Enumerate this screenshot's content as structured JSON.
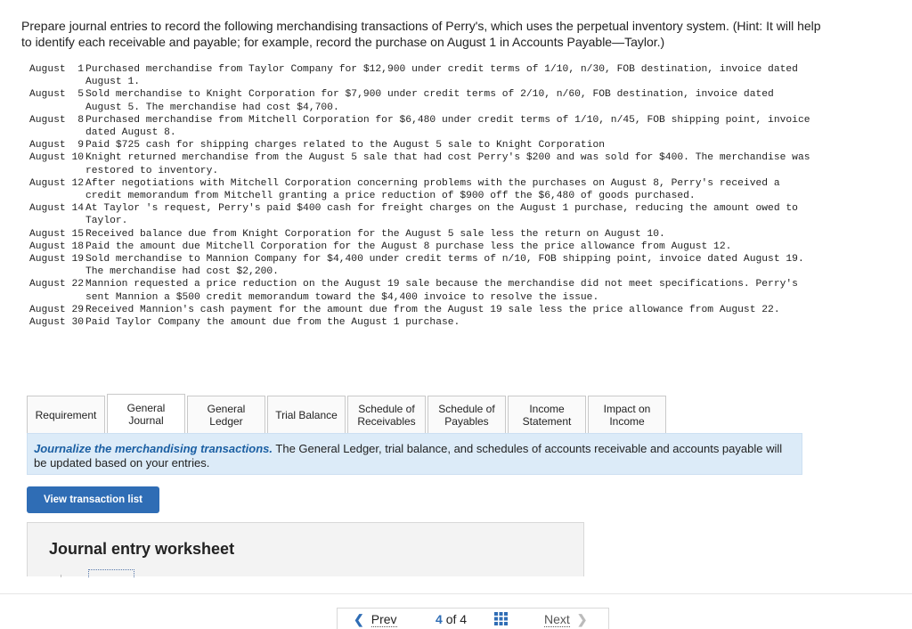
{
  "prompt": {
    "text": "Prepare journal entries to record the following merchandising transactions of Perry's, which uses the perpetual inventory system. (Hint: It will help to identify each receivable and payable; for example, record the purchase on August 1 in Accounts Payable—Taylor.)"
  },
  "transactions": [
    {
      "date": "August  1",
      "text": "Purchased merchandise from Taylor Company for $12,900 under credit terms of 1/10, n/30, FOB destination, invoice dated August 1."
    },
    {
      "date": "August  5",
      "text": "Sold merchandise to Knight Corporation for $7,900 under credit terms of 2/10, n/60, FOB destination, invoice dated August 5. The merchandise had cost $4,700."
    },
    {
      "date": "August  8",
      "text": "Purchased merchandise from Mitchell Corporation for $6,480 under credit terms of 1/10, n/45, FOB shipping point, invoice dated August 8."
    },
    {
      "date": "August  9",
      "text": "Paid $725 cash for shipping charges related to the August 5 sale to Knight Corporation"
    },
    {
      "date": "August 10",
      "text": "Knight returned merchandise from the August 5 sale that had cost Perry's $200 and was sold for $400. The merchandise was restored to inventory."
    },
    {
      "date": "August 12",
      "text": "After negotiations with Mitchell Corporation concerning problems with the purchases on August 8, Perry's received a credit memorandum from Mitchell granting a price reduction of $900 off the $6,480 of goods purchased."
    },
    {
      "date": "August 14",
      "text": "At Taylor 's request, Perry's paid $400 cash for freight charges on the August 1 purchase, reducing the amount owed to Taylor."
    },
    {
      "date": "August 15",
      "text": "Received balance due from Knight Corporation for the August 5 sale less the return on August 10."
    },
    {
      "date": "August 18",
      "text": "Paid the amount due Mitchell Corporation for the August 8 purchase less the price allowance from August 12."
    },
    {
      "date": "August 19",
      "text": "Sold merchandise to Mannion Company for $4,400 under credit terms of n/10, FOB shipping point, invoice dated August 19. The merchandise had cost $2,200."
    },
    {
      "date": "August 22",
      "text": "Mannion requested a price reduction on the August 19 sale because the merchandise did not meet specifications. Perry's sent Mannion a $500 credit memorandum toward the $4,400 invoice to resolve the issue."
    },
    {
      "date": "August 29",
      "text": "Received Mannion's cash payment for the amount due from the August 19 sale less the price allowance from August 22."
    },
    {
      "date": "August 30",
      "text": "Paid Taylor Company the amount due from the August 1 purchase."
    }
  ],
  "tabs": [
    {
      "label": "Requirement",
      "active": false
    },
    {
      "label": "General\nJournal",
      "active": true
    },
    {
      "label": "General\nLedger",
      "active": false
    },
    {
      "label": "Trial Balance",
      "active": false
    },
    {
      "label": "Schedule of\nReceivables",
      "active": false
    },
    {
      "label": "Schedule of\nPayables",
      "active": false
    },
    {
      "label": "Income\nStatement",
      "active": false
    },
    {
      "label": "Impact on\nIncome",
      "active": false
    }
  ],
  "banner": {
    "emphasis": "Journalize the merchandising transactions.",
    "text": " The General Ledger, trial balance, and schedules of accounts receivable and accounts payable will be updated based on your entries."
  },
  "view_button": {
    "label": "View transaction list"
  },
  "worksheet": {
    "title": "Journal entry worksheet"
  },
  "pager": {
    "prev_label": "Prev",
    "current": "4",
    "of_label": "of",
    "total": "4",
    "next_label": "Next",
    "prev_icon": "chevron-left-icon",
    "next_icon": "chevron-right-icon",
    "grid_icon": "grid-icon",
    "accent_color": "#2f6db5"
  }
}
